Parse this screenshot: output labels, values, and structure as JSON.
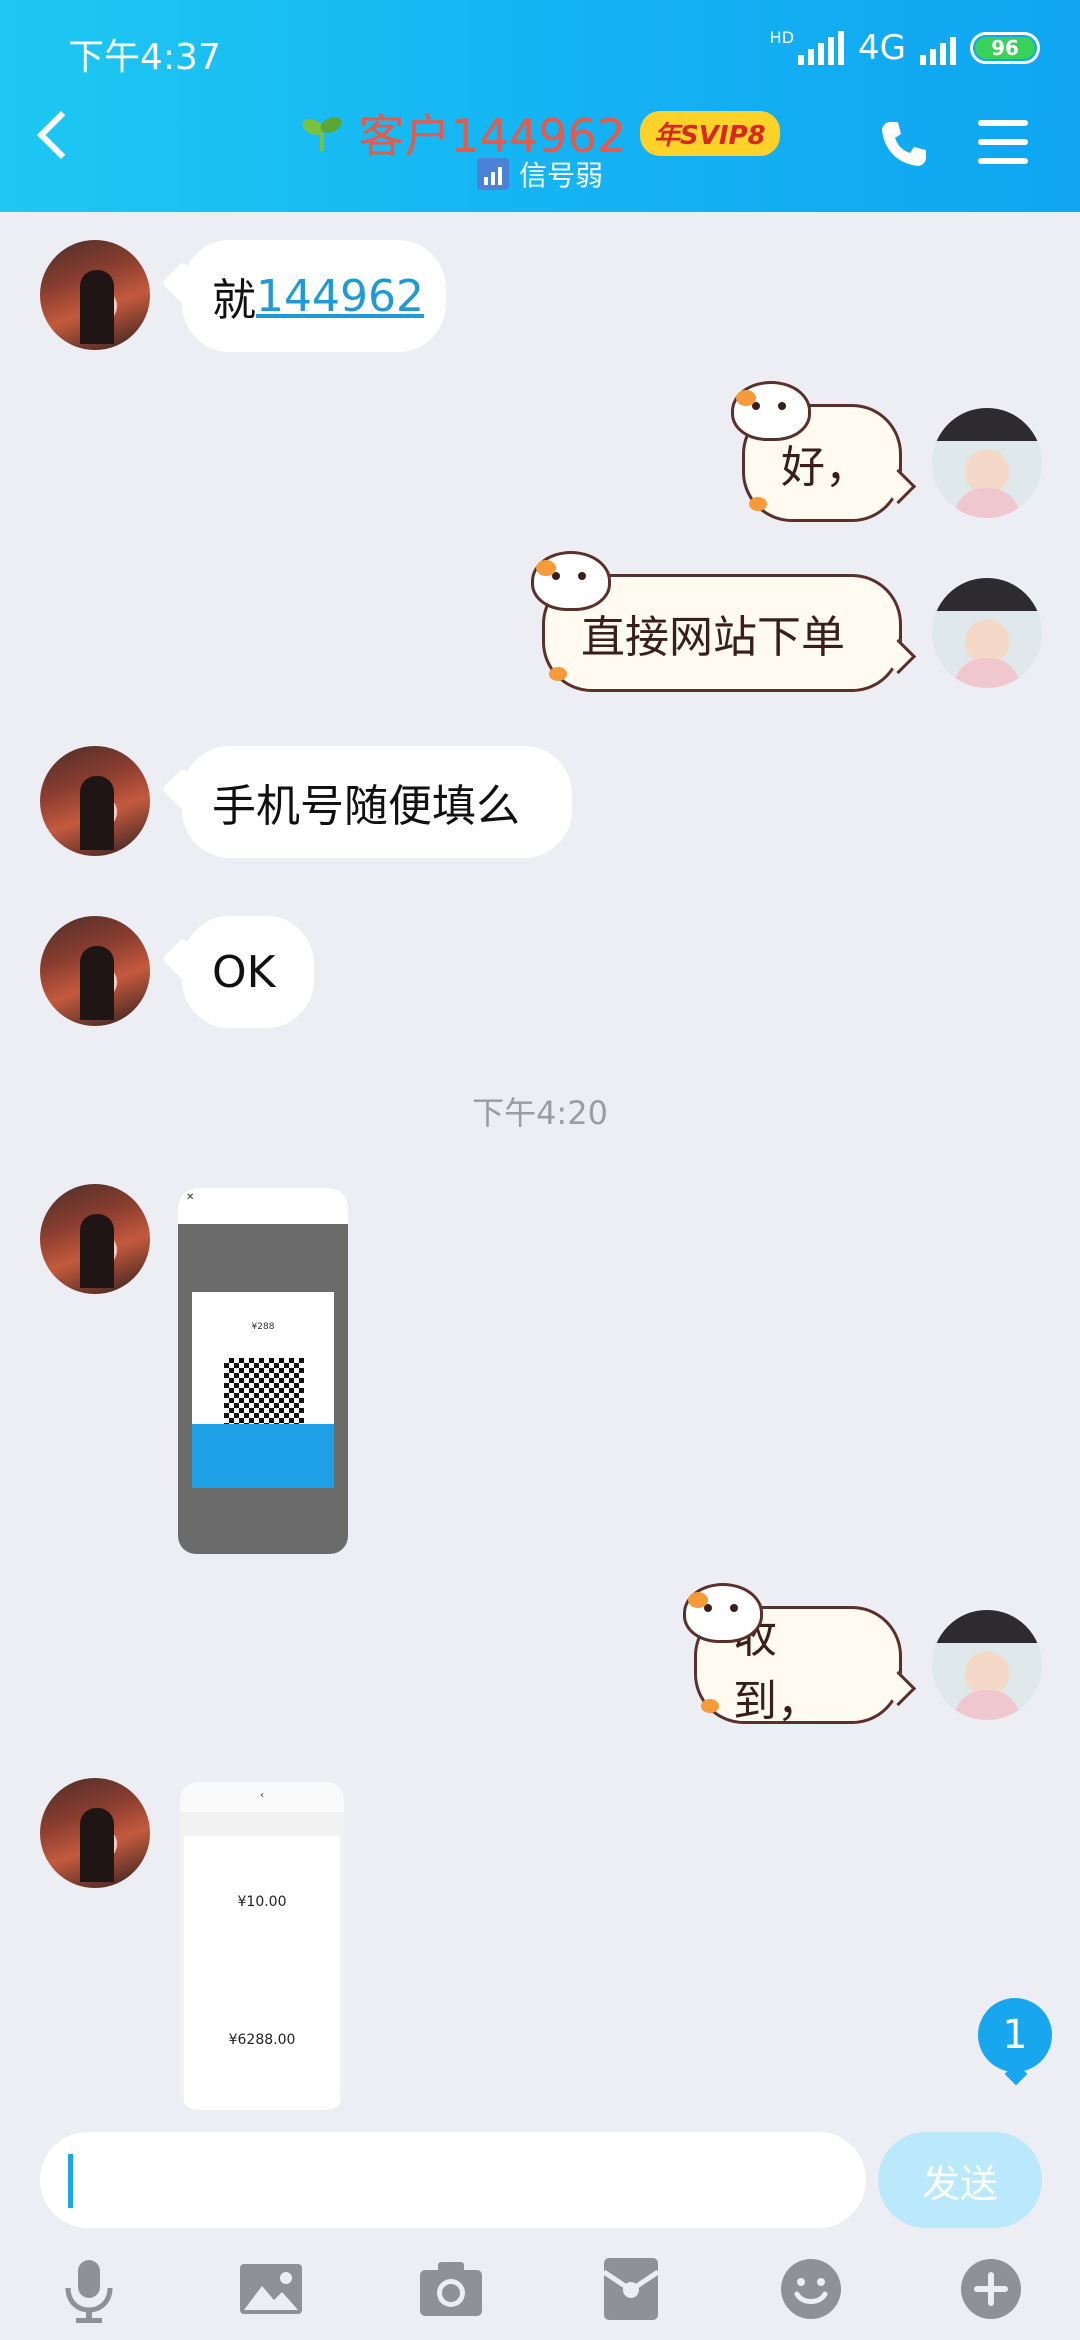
{
  "status_bar": {
    "time": "下午4:37",
    "network_hd": "HD",
    "network": "4G",
    "battery": "96"
  },
  "header": {
    "title": "客户144962",
    "vip_badge": "年SVIP8",
    "subtitle": "信号弱"
  },
  "messages": [
    {
      "side": "left",
      "prefix": "就",
      "link": "144962"
    },
    {
      "side": "right",
      "sticker": true,
      "text": "好，"
    },
    {
      "side": "right",
      "sticker": true,
      "text": "直接网站下单"
    },
    {
      "side": "left",
      "text": "手机号随便填么"
    },
    {
      "side": "left",
      "text": "OK"
    },
    {
      "timestamp": "下午4:20"
    },
    {
      "side": "left",
      "image": "payment-qr-screenshot"
    },
    {
      "side": "right",
      "sticker": true,
      "text": "收到，"
    },
    {
      "side": "left",
      "image": "payment-receipt-screenshot"
    }
  ],
  "shots": {
    "qr": {
      "amount_label": "¥288"
    },
    "receipt": {
      "amount1": "¥10.00",
      "amount2": "¥6288.00"
    }
  },
  "unread_badge": "1",
  "input": {
    "value": "",
    "send_label": "发送"
  },
  "toolbar_icons": [
    "microphone-icon",
    "image-icon",
    "camera-icon",
    "red-packet-icon",
    "emoji-icon",
    "plus-icon"
  ],
  "colors": {
    "header_blue": "#14b2f3",
    "title_red": "#e9594a",
    "badge_blue": "#18a6ee",
    "send_light": "#b9e9fb"
  }
}
